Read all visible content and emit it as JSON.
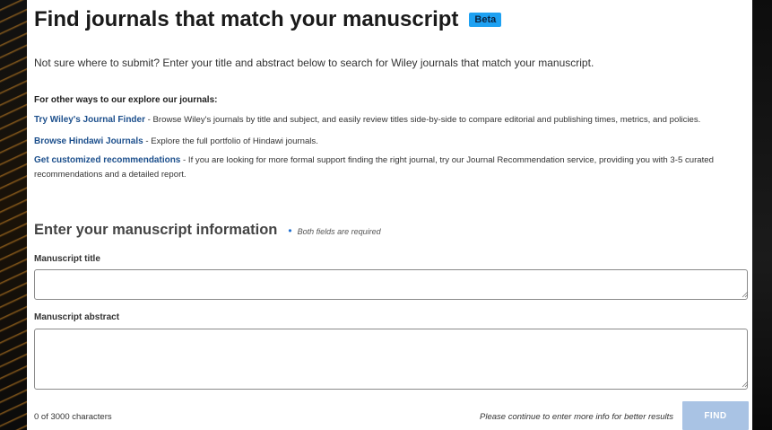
{
  "header": {
    "title": "Find journals that match your manuscript",
    "badge": "Beta"
  },
  "intro": "Not sure where to submit? Enter your title and abstract below to search for Wiley journals that match your manuscript.",
  "other_ways": {
    "heading": "For other ways to our explore our journals:",
    "items": [
      {
        "link": "Try Wiley's Journal Finder",
        "text": " - Browse Wiley's journals by title and subject, and easily review titles side-by-side to compare editorial and publishing times, metrics, and policies."
      },
      {
        "link": "Browse Hindawi Journals",
        "text": " - Explore the full portfolio of Hindawi journals."
      },
      {
        "link": "Get customized recommendations",
        "text": " - If you are looking for more formal support finding the right journal, try our Journal Recommendation service, providing you with 3-5 curated recommendations and a detailed report."
      }
    ]
  },
  "form": {
    "section_title": "Enter your manuscript information",
    "required_note": "Both fields are required",
    "title_label": "Manuscript title",
    "title_value": "",
    "abstract_label": "Manuscript abstract",
    "abstract_value": "",
    "char_count": "0 of 3000 characters",
    "hint": "Please continue to enter more info for better results",
    "submit_label": "FIND"
  },
  "colors": {
    "link": "#1c4f8c",
    "badge_bg": "#1ea1f2",
    "button_disabled": "#a9c3e4",
    "bullet": "#1f6fd1"
  },
  "icons": [
    "resize-grip-icon"
  ]
}
